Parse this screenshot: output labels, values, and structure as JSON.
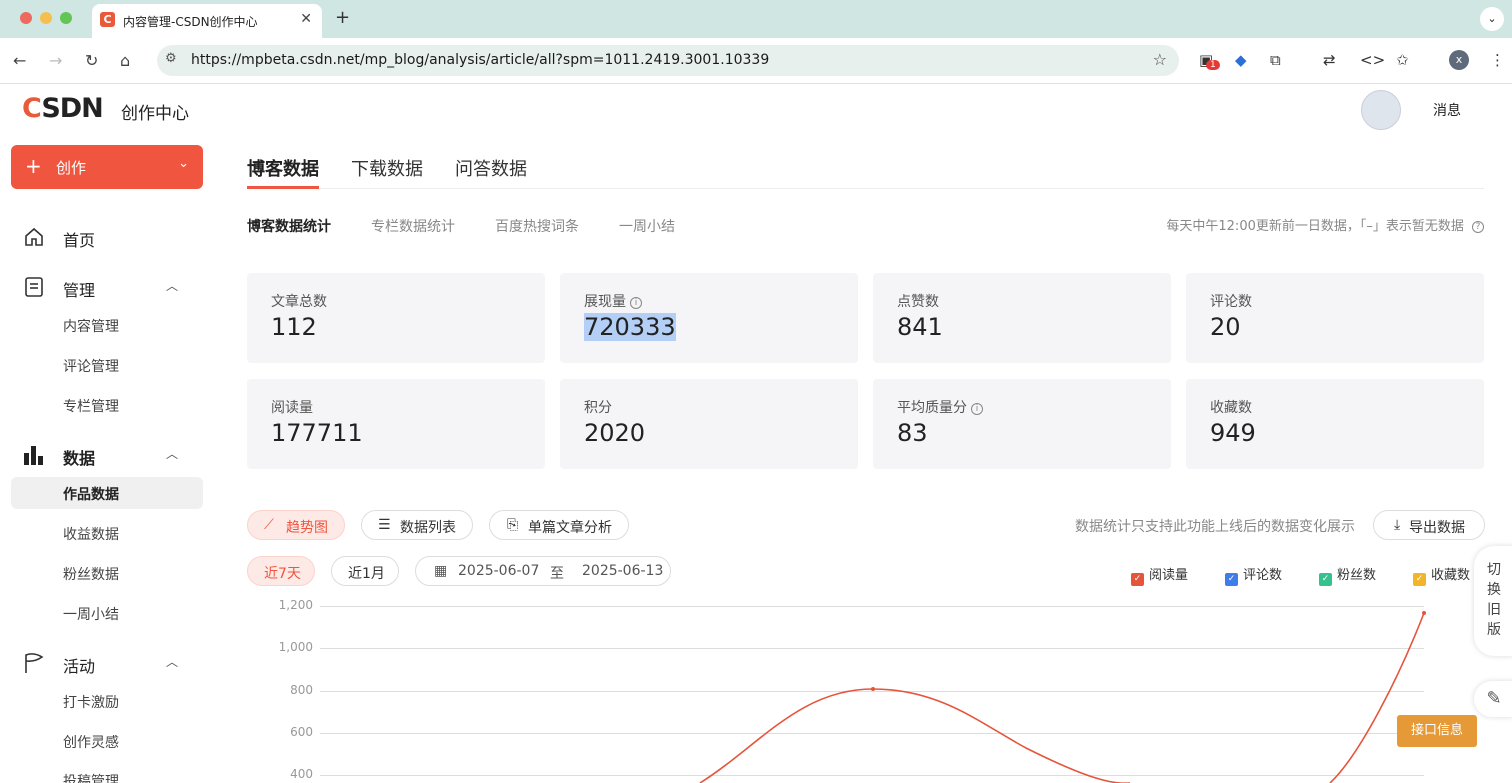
{
  "browser": {
    "tab_title": "内容管理-CSDN创作中心",
    "favicon_letter": "C",
    "url": "https://mpbeta.csdn.net/mp_blog/analysis/article/all?spm=1011.2419.3001.10339",
    "ext_badge": "1",
    "profile_letter": "x"
  },
  "header": {
    "logo_c": "C",
    "logo_rest": "SDN",
    "center_title": "创作中心",
    "messages": "消息"
  },
  "sidebar": {
    "create": "创作",
    "sections": [
      {
        "label": "首页"
      },
      {
        "label": "管理",
        "items": [
          "内容管理",
          "评论管理",
          "专栏管理"
        ]
      },
      {
        "label": "数据",
        "items": [
          "作品数据",
          "收益数据",
          "粉丝数据",
          "一周小结"
        ]
      },
      {
        "label": "活动",
        "items": [
          "打卡激励",
          "创作灵感",
          "投稿管理"
        ]
      }
    ]
  },
  "main": {
    "tabs": [
      "博客数据",
      "下载数据",
      "问答数据"
    ],
    "subtabs": [
      "博客数据统计",
      "专栏数据统计",
      "百度热搜词条",
      "一周小结"
    ],
    "update_note": "每天中午12:00更新前一日数据，「–」表示暂无数据",
    "stats": [
      {
        "label": "文章总数",
        "value": "112"
      },
      {
        "label": "展现量",
        "value": "720333"
      },
      {
        "label": "点赞数",
        "value": "841"
      },
      {
        "label": "评论数",
        "value": "20"
      },
      {
        "label": "阅读量",
        "value": "177711"
      },
      {
        "label": "积分",
        "value": "2020"
      },
      {
        "label": "平均质量分",
        "value": "83"
      },
      {
        "label": "收藏数",
        "value": "949"
      }
    ],
    "views": [
      "趋势图",
      "数据列表",
      "单篇文章分析"
    ],
    "stat_note": "数据统计只支持此功能上线后的数据变化展示",
    "export": "导出数据",
    "ranges": [
      "近7天",
      "近1月"
    ],
    "date_from": "2025-06-07",
    "date_sep": "至",
    "date_to": "2025-06-13",
    "legend": [
      "阅读量",
      "评论数",
      "粉丝数",
      "收藏数"
    ],
    "legend_colors": [
      "#e5553c",
      "#3f7ee8",
      "#36c28f",
      "#f2b52a"
    ],
    "switch_old": "切换旧版",
    "api_info": "接口信息"
  },
  "chart_data": {
    "type": "line",
    "y_ticks": [
      "1,200",
      "1,000",
      "800",
      "600",
      "400"
    ],
    "ylim": [
      400,
      1200
    ],
    "series": [
      {
        "name": "阅读量",
        "color": "#e5553c"
      }
    ]
  }
}
